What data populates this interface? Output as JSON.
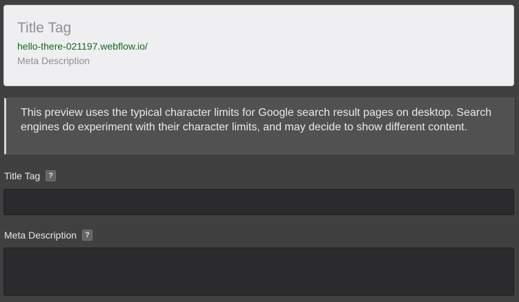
{
  "preview": {
    "title": "Title Tag",
    "url": "hello-there-021197.webflow.io/",
    "description": "Meta Description"
  },
  "notice": {
    "text": "This preview uses the typical character limits for Google search result pages on desktop. Search engines do experiment with their character limits, and may decide to show different content."
  },
  "fields": {
    "title_tag": {
      "label": "Title Tag",
      "help": "?",
      "value": "",
      "placeholder": ""
    },
    "meta_description": {
      "label": "Meta Description",
      "help": "?",
      "value": "",
      "placeholder": ""
    }
  },
  "colors": {
    "background": "#404040",
    "preview_card": "#efeef1",
    "url_green": "#0f6b1e",
    "input_background": "#2b2a2c",
    "notice_background": "#525152"
  }
}
